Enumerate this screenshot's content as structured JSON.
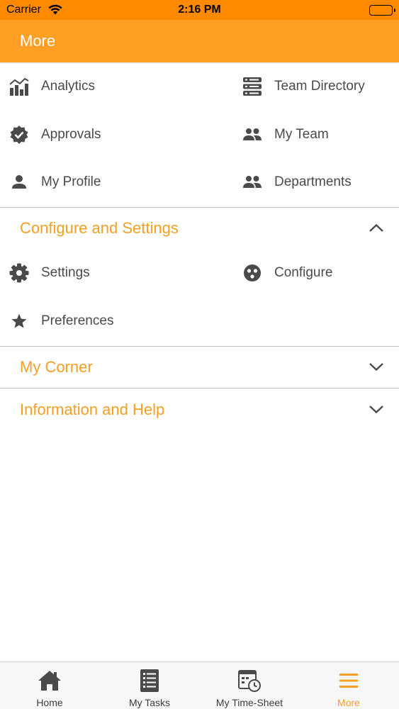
{
  "status_bar": {
    "carrier": "Carrier",
    "time": "2:16 PM"
  },
  "nav": {
    "title": "More"
  },
  "main_items": [
    {
      "label": "Analytics",
      "icon": "analytics-icon"
    },
    {
      "label": "Team Directory",
      "icon": "database-icon"
    },
    {
      "label": "Approvals",
      "icon": "verified-badge-icon"
    },
    {
      "label": "My Team",
      "icon": "group-icon"
    },
    {
      "label": "My Profile",
      "icon": "person-icon"
    },
    {
      "label": "Departments",
      "icon": "group-icon"
    }
  ],
  "sections": [
    {
      "title": "Configure and Settings",
      "expanded": true,
      "items": [
        {
          "label": "Settings",
          "icon": "gear-icon"
        },
        {
          "label": "Configure",
          "icon": "configure-icon"
        },
        {
          "label": "Preferences",
          "icon": "star-icon"
        }
      ]
    },
    {
      "title": "My Corner",
      "expanded": false,
      "items": []
    },
    {
      "title": "Information and Help",
      "expanded": false,
      "items": []
    }
  ],
  "tabs": [
    {
      "label": "Home",
      "icon": "home-icon",
      "active": false
    },
    {
      "label": "My Tasks",
      "icon": "task-list-icon",
      "active": false
    },
    {
      "label": "My Time-Sheet",
      "icon": "timesheet-icon",
      "active": false
    },
    {
      "label": "More",
      "icon": "menu-icon",
      "active": true
    }
  ],
  "colors": {
    "status_bar": "#ff8a00",
    "nav_bar": "#ffa024",
    "accent": "#f4a024",
    "icon": "#4a4a4a",
    "divider": "#bdbdbd"
  }
}
